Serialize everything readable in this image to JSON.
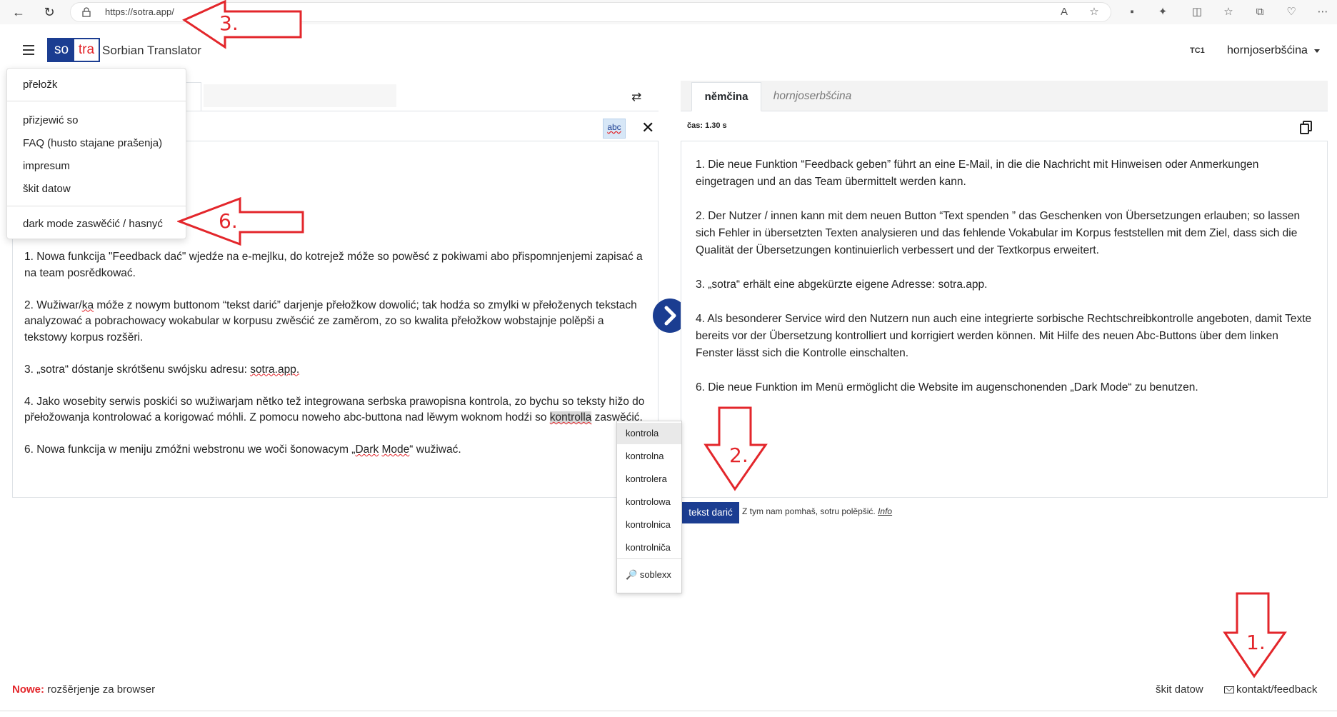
{
  "browser": {
    "url": "https://sotra.app/"
  },
  "header": {
    "logo_so": "so",
    "logo_tra": "tra",
    "title": "Sorbian Translator",
    "badge": "TC1",
    "ui_language": "hornjoserbšćina"
  },
  "menu": {
    "items": [
      {
        "label": "přełožk"
      },
      {
        "label": "přizjewić so"
      },
      {
        "label": "FAQ (husto stajane prašenja)"
      },
      {
        "label": "impresum"
      },
      {
        "label": "škit datow"
      },
      {
        "label": "dark mode zaswěćić / hasnyć"
      }
    ]
  },
  "left_panel": {
    "spellcheck_label": "abc",
    "close_label": "✕",
    "swap_label": "⇄",
    "paragraphs": [
      "1. Nowa funkcija \"Feedback dać\" wjedźe na e-mejlku, do kotrejež móže so powěsć z pokiwami abo přispomnjenjemi zapisać a na team posrědkować.",
      "3. „sotra“ dóstanje skrótšenu swójsku adresu: sotra.app.",
      "6. Nowa funkcija w meniju zmóžni webstronu we woči šonowacym „Dark Mode“ wužiwać."
    ],
    "p2_a": "2. Wužiwar/",
    "p2_b": "ka",
    "p2_c": " móže z nowym buttonom “tekst darić” darjenje přełožkow dowolić; tak hodźa so zmylki w přełoženych tekstach analyzować a pobrachowacy wokabular w korpusu zwěsćić ze zaměrom, zo so kwalita přełožkow wobstajnje polěpši a tekstowy korpus rozšěri.",
    "p3_a": "3. „sotra“ dóstanje skrótšenu swójsku adresu: ",
    "p3_b": "sotra.app.",
    "p4_a": "4. Jako wosebity serwis poskići so wužiwarjam nětko tež integrowana serbska prawopisna kontrola, zo bychu so teksty hižo do přełožowanja kontrolować a korigować móhli. Z pomocu noweho abc-buttona nad lěwym woknom hodźi so ",
    "p4_b": "kontrolla",
    "p4_c": " zaswěćić.",
    "p6_a": "6. Nowa funkcija w meniju zmóžni webstronu we woči šonowacym „",
    "p6_b": "Dark",
    "p6_c": " ",
    "p6_d": "Mode",
    "p6_e": "“ wužiwać."
  },
  "spell_suggestions": {
    "items": [
      "kontrola",
      "kontrolna",
      "kontrolera",
      "kontrolowa",
      "kontrolnica",
      "kontrolniča"
    ],
    "dictionary": "soblexx"
  },
  "right_panel": {
    "tabs": [
      {
        "label": "němčina",
        "active": true
      },
      {
        "label": "hornjoserbšćina",
        "active": false
      }
    ],
    "time": "čas: 1.30 s",
    "paragraphs": [
      "1. Die neue Funktion “Feedback geben” führt an eine E-Mail, in die die Nachricht mit Hinweisen oder Anmerkungen eingetragen und an das Team übermittelt werden kann.",
      "2. Der Nutzer / innen kann mit dem neuen Button “Text spenden ” das Geschenken von Übersetzungen erlauben; so lassen sich Fehler in übersetzten Texten analysieren und das fehlende Vokabular im Korpus feststellen mit dem Ziel, dass sich die Qualität der Übersetzungen kontinuierlich verbessert und der Textkorpus erweitert.",
      "3. „sotra“ erhält eine abgekürzte eigene Adresse: sotra.app.",
      "4. Als besonderer Service wird den Nutzern nun auch eine integrierte sorbische Rechtschreibkontrolle angeboten, damit Texte bereits vor der Übersetzung kontrolliert und korrigiert werden können. Mit Hilfe des neuen Abc-Buttons über dem linken Fenster lässt sich die Kontrolle einschalten.",
      "6. Die neue Funktion im Menü ermöglicht die Website im augenschonenden „Dark Mode“ zu benutzen."
    ],
    "donate_button": "tekst darić",
    "donate_note": "Z tym nam pomhaš, sotru polěpšić.",
    "donate_info": "Info"
  },
  "footer": {
    "new_label": "Nowe:",
    "new_text": "rozšěrjenje za browser",
    "privacy": "škit datow",
    "contact": "kontakt/feedback"
  },
  "annotations": [
    "1.",
    "2.",
    "3.",
    "6."
  ],
  "colors": {
    "brand_blue": "#1b3d91",
    "brand_red": "#e3262b",
    "annotation_red": "#e3262b"
  }
}
